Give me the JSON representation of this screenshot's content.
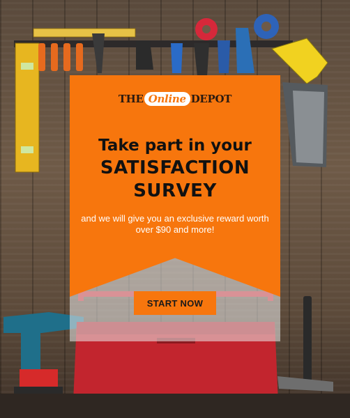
{
  "brand": {
    "logo_prefix": "THE",
    "logo_pill": "Online",
    "logo_suffix": "DEPOT"
  },
  "headline": {
    "line1": "Take part in your",
    "line2": "SATISFACTION",
    "line3": "SURVEY"
  },
  "subtext": "and we will give you an exclusive reward worth over $90 and more!",
  "cta": {
    "label": "START NOW"
  },
  "colors": {
    "accent": "#f7760d",
    "text_dark": "#111111",
    "wood": "#5e4a3a"
  }
}
